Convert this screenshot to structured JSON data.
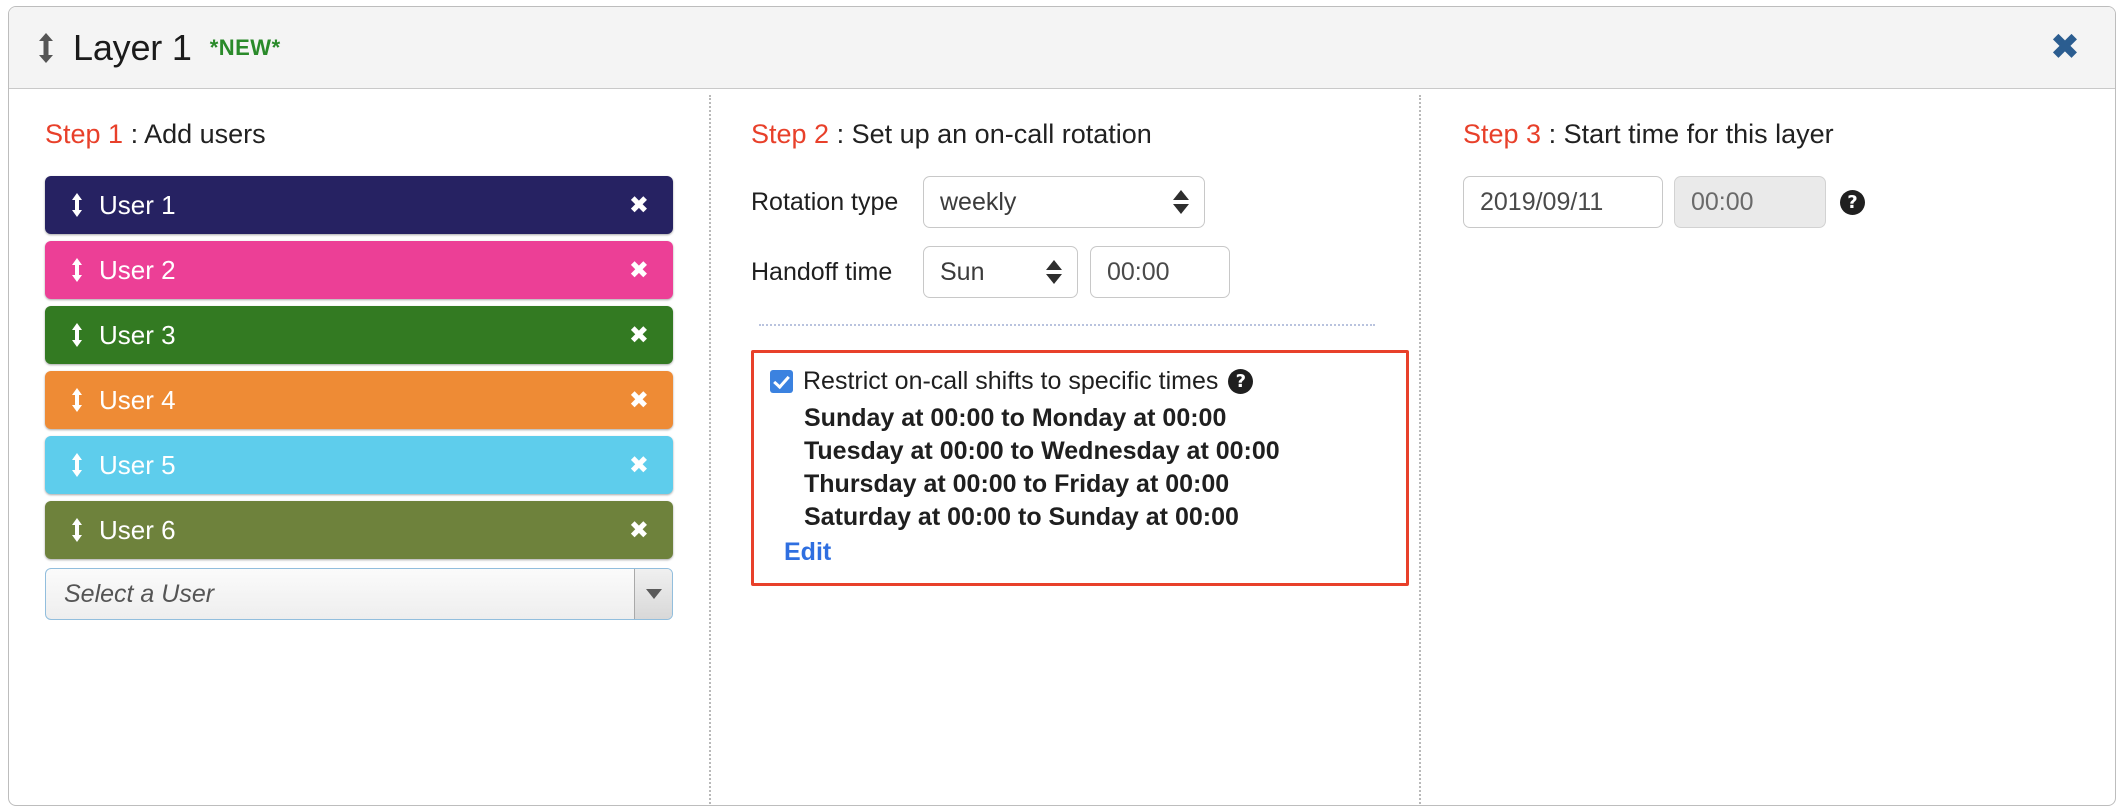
{
  "header": {
    "drag_icon": "vertical-drag-arrows-icon",
    "title": "Layer 1",
    "badge": "*NEW*",
    "close_icon": "close-icon",
    "close_label": "✖",
    "close_color": "#2b5d90"
  },
  "step1": {
    "step_num": "Step 1",
    "separator": " : ",
    "heading": "Add users",
    "users": [
      {
        "label": "User 1",
        "color": "#262262",
        "remove_label": "✖",
        "grip_icon": "drag-handle-icon"
      },
      {
        "label": "User 2",
        "color": "#ec3f96",
        "remove_label": "✖",
        "grip_icon": "drag-handle-icon"
      },
      {
        "label": "User 3",
        "color": "#337a22",
        "remove_label": "✖",
        "grip_icon": "drag-handle-icon"
      },
      {
        "label": "User 4",
        "color": "#ee8b35",
        "remove_label": "✖",
        "grip_icon": "drag-handle-icon"
      },
      {
        "label": "User 5",
        "color": "#5ecdec",
        "remove_label": "✖",
        "grip_icon": "drag-handle-icon"
      },
      {
        "label": "User 6",
        "color": "#6e823c",
        "remove_label": "✖",
        "grip_icon": "drag-handle-icon"
      }
    ],
    "user_select_placeholder": "Select a User",
    "user_select_caret": "chevron-down-icon"
  },
  "step2": {
    "step_num": "Step 2",
    "separator": " : ",
    "heading": "Set up an on-call rotation",
    "rotation_type_label": "Rotation type",
    "rotation_type_value": "weekly",
    "handoff_label": "Handoff time",
    "handoff_day_value": "Sun",
    "handoff_time_value": "00:00",
    "handoff_time_placeholder": "00:00",
    "restrict": {
      "checked": true,
      "label": "Restrict on-call shifts to specific times",
      "help_label": "?",
      "items": [
        "Sunday at 00:00 to Monday at 00:00",
        "Tuesday at 00:00 to Wednesday at 00:00",
        "Thursday at 00:00 to Friday at 00:00",
        "Saturday at 00:00 to Sunday at 00:00"
      ],
      "edit_label": "Edit",
      "border_color": "#e8402a"
    }
  },
  "step3": {
    "step_num": "Step 3",
    "separator": " : ",
    "heading": "Start time for this layer",
    "date_value": "2019/09/11",
    "date_placeholder": "YYYY/MM/DD",
    "time_value": "00:00",
    "time_placeholder": "00:00",
    "help_label": "?"
  },
  "theme": {
    "accent_red": "#e8402a",
    "link_blue": "#2f6fe0",
    "new_green": "#2a8a2a",
    "checkbox_blue": "#3b82e0"
  }
}
